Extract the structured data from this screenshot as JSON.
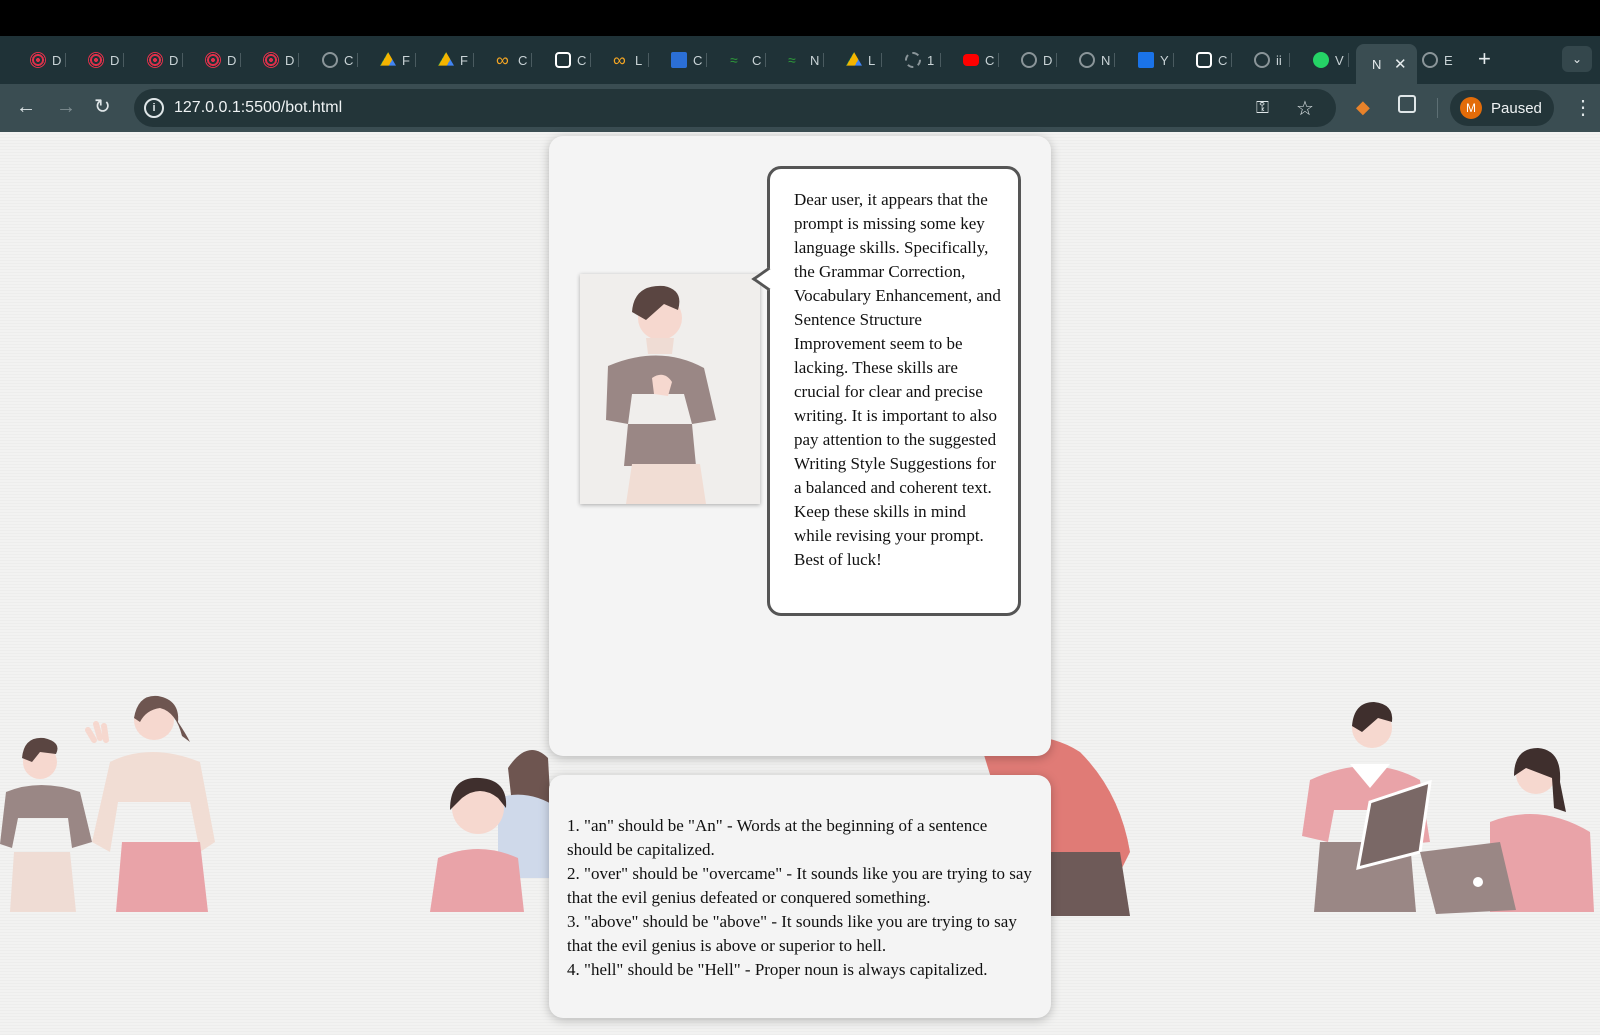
{
  "browser": {
    "tabs": [
      {
        "label": "D",
        "icon": "target-icon",
        "color": "#e0304a"
      },
      {
        "label": "D",
        "icon": "target-icon",
        "color": "#e0304a"
      },
      {
        "label": "D",
        "icon": "target-icon",
        "color": "#e0304a"
      },
      {
        "label": "D",
        "icon": "target-icon",
        "color": "#e0304a"
      },
      {
        "label": "D",
        "icon": "target-icon",
        "color": "#e0304a"
      },
      {
        "label": "C",
        "icon": "globe-icon",
        "color": "#8a9599"
      },
      {
        "label": "F",
        "icon": "drive-icon",
        "color": "#f4b400"
      },
      {
        "label": "F",
        "icon": "drive-icon",
        "color": "#f4b400"
      },
      {
        "label": "C",
        "icon": "infinity-icon",
        "color": "#f5a623"
      },
      {
        "label": "C",
        "icon": "openai-icon",
        "color": "#ffffff"
      },
      {
        "label": "L",
        "icon": "infinity-icon",
        "color": "#f5a623"
      },
      {
        "label": "C",
        "icon": "sf-icon",
        "color": "#2b6fd6"
      },
      {
        "label": "C",
        "icon": "wave-icon",
        "color": "#2e9d3a"
      },
      {
        "label": "N",
        "icon": "wave-icon",
        "color": "#2e9d3a"
      },
      {
        "label": "L",
        "icon": "drive-icon",
        "color": "#f4b400"
      },
      {
        "label": "1",
        "icon": "dashed-circle-icon",
        "color": "#8a9599"
      },
      {
        "label": "C",
        "icon": "youtube-icon",
        "color": "#ff0000"
      },
      {
        "label": "D",
        "icon": "globe-icon",
        "color": "#8a9599"
      },
      {
        "label": "N",
        "icon": "globe-icon",
        "color": "#8a9599"
      },
      {
        "label": "Y",
        "icon": "s-icon",
        "color": "#1a73e8"
      },
      {
        "label": "C",
        "icon": "openai-icon",
        "color": "#ffffff"
      },
      {
        "label": "ii",
        "icon": "globe-icon",
        "color": "#8a9599"
      },
      {
        "label": "V",
        "icon": "whatsapp-icon",
        "color": "#25d366"
      }
    ],
    "active_tab": {
      "label": "N"
    },
    "after_tab": {
      "label": "E",
      "icon": "globe-icon",
      "color": "#8a9599"
    },
    "url": "127.0.0.1:5500/bot.html",
    "profile_initial": "M",
    "profile_label": "Paused"
  },
  "bot": {
    "message": "Dear user, it appears that the prompt is missing some key language skills. Specifically, the Grammar Correction, Vocabulary Enhancement, and Sentence Structure Improvement seem to be lacking. These skills are crucial for clear and precise writing. It is important to also pay attention to the suggested Writing Style Suggestions for a balanced and coherent text. Keep these skills in mind while revising your prompt. Best of luck!"
  },
  "corrections": [
    "1. \"an\" should be \"An\" - Words at the beginning of a sentence should be capitalized.",
    "2. \"over\" should be \"overcame\" - It sounds like you are trying to say that the evil genius defeated or conquered something.",
    "3. \"above\" should be \"above\" - It sounds like you are trying to say that the evil genius is above or superior to hell.",
    "4. \"hell\" should be \"Hell\" - Proper noun is always capitalized."
  ],
  "colors": {
    "tabbar": "#1f3237",
    "toolbar": "#3a4d52",
    "card": "#f4f4f4",
    "illustration_pink": "#e9a3a8",
    "illustration_brown": "#9a8785"
  }
}
